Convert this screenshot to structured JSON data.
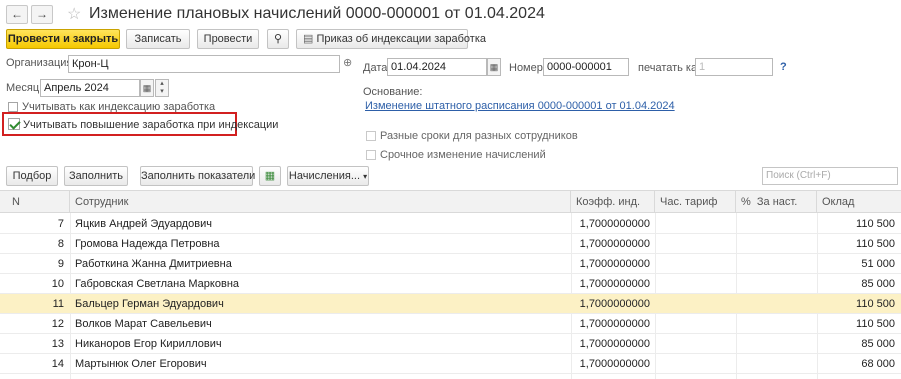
{
  "window": {
    "title": "Изменение плановых начислений 0000-000001 от 01.04.2024"
  },
  "toolbar": {
    "post_close": "Провести и закрыть",
    "save": "Записать",
    "post": "Провести",
    "print_order": "Приказ об индексации заработка"
  },
  "form": {
    "org_label": "Организация:",
    "org_value": "Крон-Ц",
    "month_label": "Месяц:",
    "month_value": "Апрель 2024",
    "date_label": "Дата:",
    "date_value": "01.04.2024",
    "number_label": "Номер:",
    "number_value": "0000-000001",
    "print_as_label": "печатать как:",
    "print_as_value": "1",
    "help": "?",
    "basis_label": "Основание:",
    "basis_link": "Изменение штатного расписания 0000-000001 от 01.04.2024",
    "cb_indexation": "Учитывать как индексацию заработка",
    "cb_raise": "Учитывать повышение заработка при индексации",
    "cb_diff_terms": "Разные сроки для разных сотрудников",
    "cb_urgent": "Срочное изменение начислений"
  },
  "table_toolbar": {
    "select": "Подбор",
    "fill": "Заполнить",
    "fill_indicators": "Заполнить показатели",
    "accruals": "Начисления...",
    "search_placeholder": "Поиск (Ctrl+F)"
  },
  "table": {
    "columns": [
      "N",
      "Сотрудник",
      "Коэфф. инд.",
      "Час. тариф",
      "%",
      "За наст.",
      "Оклад"
    ],
    "rows": [
      {
        "n": "7",
        "name": "Яцкив Андрей Эдуардович",
        "coef": "1,7000000000",
        "salary": "110 500"
      },
      {
        "n": "8",
        "name": "Громова Надежда Петровна",
        "coef": "1,7000000000",
        "salary": "110 500"
      },
      {
        "n": "9",
        "name": "Работкина Жанна Дмитриевна",
        "coef": "1,7000000000",
        "salary": "51 000"
      },
      {
        "n": "10",
        "name": "Габровская Светлана Марковна",
        "coef": "1,7000000000",
        "salary": "85 000"
      },
      {
        "n": "11",
        "name": "Бальцер Герман Эдуардович",
        "coef": "1,7000000000",
        "salary": "110 500"
      },
      {
        "n": "12",
        "name": "Волков Марат Савельевич",
        "coef": "1,7000000000",
        "salary": "110 500"
      },
      {
        "n": "13",
        "name": "Никаноров Егор Кириллович",
        "coef": "1,7000000000",
        "salary": "85 000"
      },
      {
        "n": "14",
        "name": "Мартынюк Олег Егорович",
        "coef": "1,7000000000",
        "salary": "68 000"
      }
    ],
    "selected_row": 4
  },
  "colors": {
    "primary_button": "#f5c800",
    "selected_row": "#fcf1c5",
    "highlight_border": "#d22020",
    "link": "#2d5fa8"
  }
}
